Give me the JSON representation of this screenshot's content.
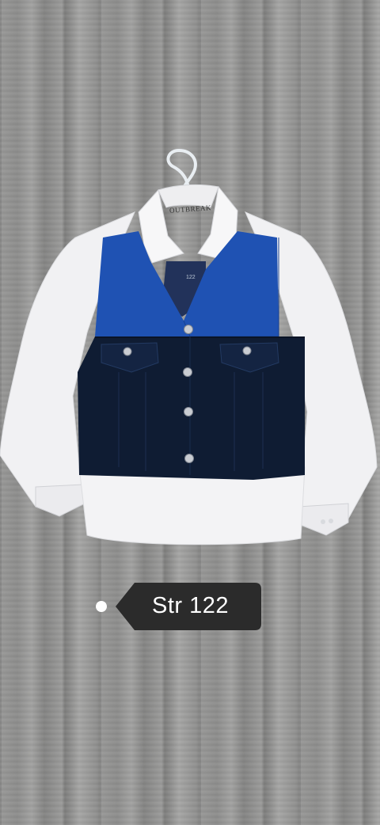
{
  "product": {
    "brand_label": "OUTBREAK",
    "inner_size_label": "122",
    "size_tag": "Str 122",
    "colors": {
      "shirt": "#f2f2f4",
      "vest_top": "#1d4fae",
      "vest_bottom": "#0f1c33",
      "buttons": "#c9ccd2",
      "tag_bg": "#2b2b2b",
      "floor": "#959594"
    }
  }
}
